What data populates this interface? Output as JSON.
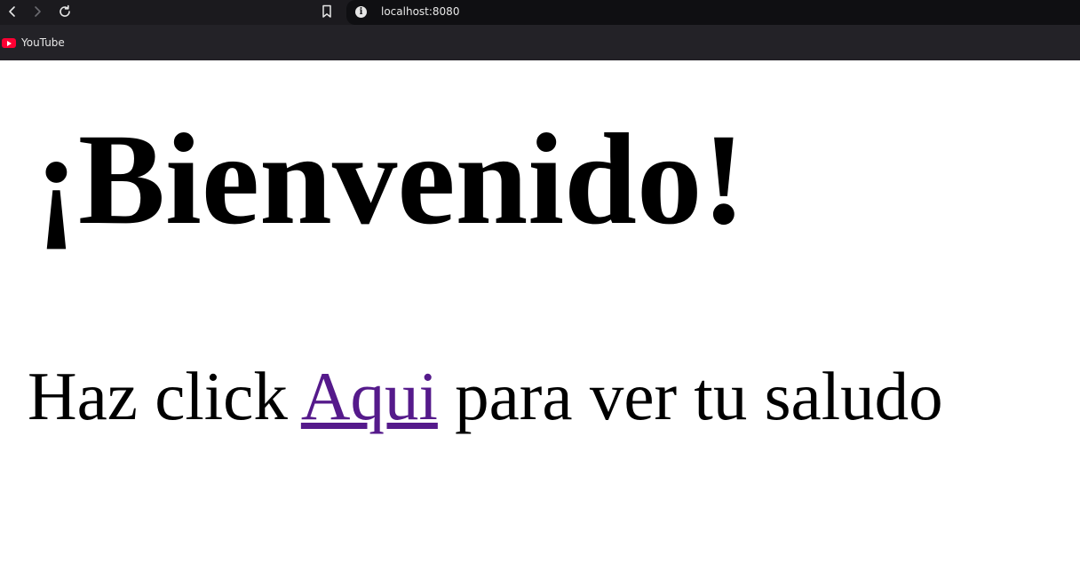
{
  "browser": {
    "url": "localhost:8080",
    "bookmarks": [
      {
        "label": "YouTube",
        "icon": "youtube-icon"
      }
    ],
    "icons": {
      "back": "chevron-left-icon",
      "forward": "chevron-right-icon",
      "reload": "reload-icon",
      "bookmark": "bookmark-icon",
      "site_info": "info-icon"
    }
  },
  "page": {
    "heading": "¡Bienvenido!",
    "text_before_link": "Haz click ",
    "link_text": "Aqui",
    "text_after_link": " para ver tu saludo",
    "link_color": "#551a8b"
  }
}
